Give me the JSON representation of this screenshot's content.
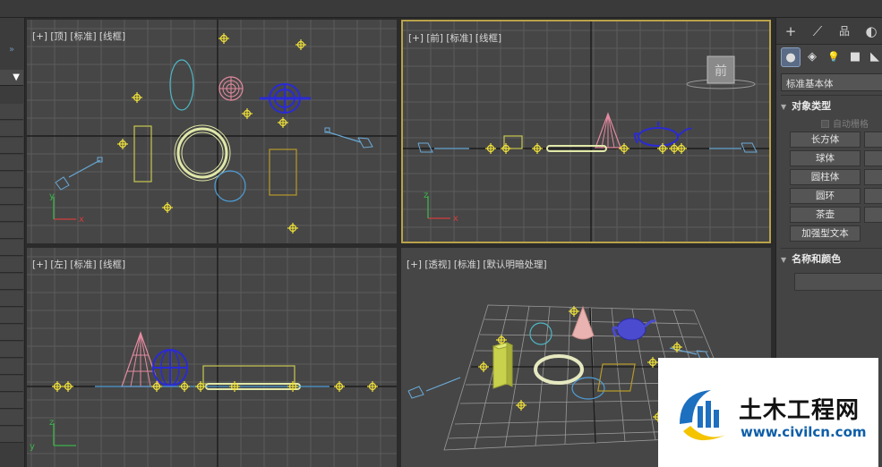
{
  "viewports": {
    "top": {
      "label": "[+] [顶] [标准] [线框]"
    },
    "front": {
      "label": "[+] [前] [标准] [线框]",
      "viewcube_label": "前"
    },
    "left": {
      "label": "[+] [左] [标准] [线框]"
    },
    "perspective": {
      "label": "[+] [透视] [标准] [默认明暗处理]"
    }
  },
  "axis_labels": {
    "x": "x",
    "y": "y",
    "z": "z"
  },
  "command_panel": {
    "tabs": [
      {
        "icon": "plus-icon",
        "glyph": "+"
      },
      {
        "icon": "modify-curve-icon",
        "glyph": "⟋"
      },
      {
        "icon": "hierarchy-icon",
        "glyph": "品"
      },
      {
        "icon": "motion-icon",
        "glyph": "◐"
      }
    ],
    "categories": [
      {
        "icon": "geometry-sphere-icon",
        "glyph": "●"
      },
      {
        "icon": "shapes-icon",
        "glyph": "◈"
      },
      {
        "icon": "lights-icon",
        "glyph": "💡"
      },
      {
        "icon": "cameras-icon",
        "glyph": "■"
      },
      {
        "icon": "helpers-icon",
        "glyph": "◣"
      }
    ],
    "dropdown_value": "标准基本体",
    "object_type_title": "对象类型",
    "autogrid_label": "自动栅格",
    "buttons": [
      "长方体",
      "球体",
      "圆柱体",
      "圆环",
      "茶壶",
      "加强型文本"
    ],
    "name_color_title": "名称和颜色"
  },
  "watermark": {
    "title": "土木工程网",
    "url": "www.civilcn.com"
  },
  "colors": {
    "viewport_bg": "#464646",
    "active_border": "#b9a24a",
    "grid": "#5a5a5a",
    "axis": "#151515"
  }
}
